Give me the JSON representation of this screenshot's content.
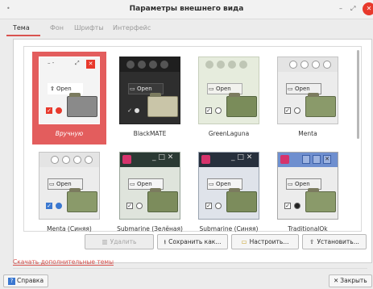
{
  "window": {
    "title": "Параметры внешнего вида",
    "menu_glyph": "•",
    "minimize": "–",
    "maximize": "⤢",
    "close": "✕"
  },
  "tabs": [
    {
      "label": "Тема",
      "active": true
    },
    {
      "label": "Фон",
      "active": false
    },
    {
      "label": "Шрифты",
      "active": false
    },
    {
      "label": "Интерфейс",
      "active": false
    }
  ],
  "themes": [
    {
      "name": "Вручную",
      "selected": true,
      "preview_button": "Open"
    },
    {
      "name": "BlackMATE",
      "selected": false,
      "preview_button": "Open"
    },
    {
      "name": "GreenLaguna",
      "selected": false,
      "preview_button": "Open"
    },
    {
      "name": "Menta",
      "selected": false,
      "preview_button": "Open"
    },
    {
      "name": "Menta (Синяя)",
      "selected": false,
      "preview_button": "Open"
    },
    {
      "name": "Submarine (Зелёная)",
      "selected": false,
      "preview_button": "Open"
    },
    {
      "name": "Submarine (Синяя)",
      "selected": false,
      "preview_button": "Open"
    },
    {
      "name": "TraditionalOk",
      "selected": false,
      "preview_button": "Open"
    }
  ],
  "actions": {
    "delete": "Удалить",
    "save_as": "Сохранить как...",
    "customize": "Настроить...",
    "install": "Установить..."
  },
  "download_link": "Скачать дополнительные темы",
  "footer": {
    "help": "Справка",
    "close": "Закрыть"
  },
  "colors": {
    "accent": "#d9534f",
    "selected_bg": "#e35d5d"
  }
}
